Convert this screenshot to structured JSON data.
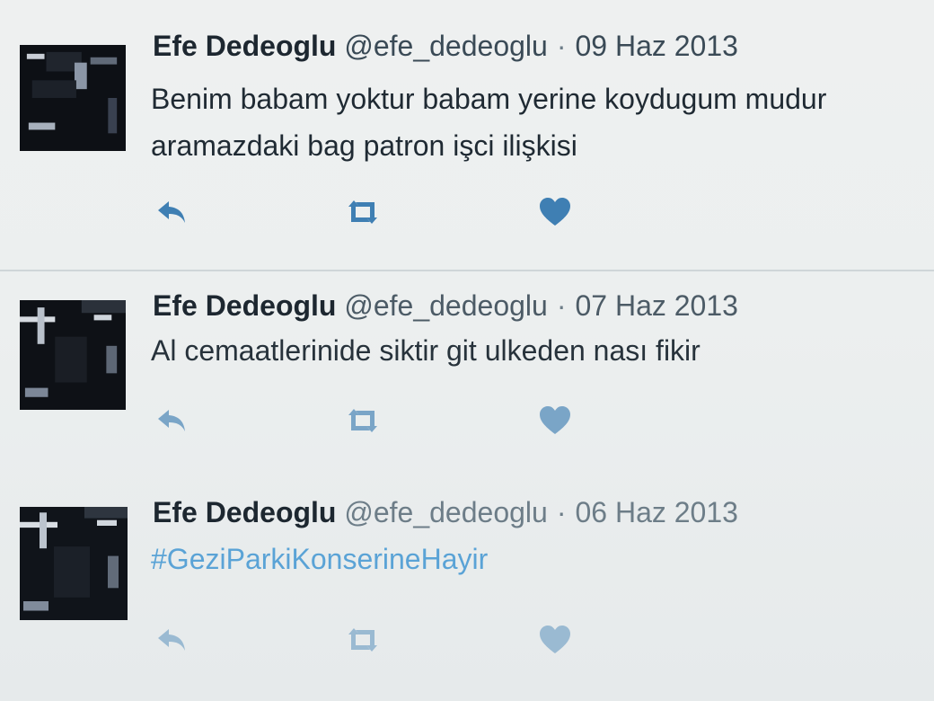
{
  "tweets": [
    {
      "name": "Efe Dedeoglu",
      "handle": "@efe_dedeoglu",
      "separator": "·",
      "date": "09 Haz 2013",
      "text_lines": [
        "Benim babam yoktur babam yerine koydugum mudur",
        "aramazdaki bag patron işci ilişkisi"
      ]
    },
    {
      "name": "Efe Dedeoglu",
      "handle": "@efe_dedeoglu",
      "separator": "·",
      "date": "07 Haz 2013",
      "text_lines": [
        "Al cemaatlerinide siktir git ulkeden nası fikir"
      ]
    },
    {
      "name": "Efe Dedeoglu",
      "handle": "@efe_dedeoglu",
      "separator": "·",
      "date": "06 Haz 2013",
      "text_lines": [
        "#GeziParkiKonserineHayir"
      ]
    }
  ],
  "icons": {
    "reply": "reply-icon",
    "retweet": "retweet-icon",
    "like": "heart-icon"
  },
  "colors": {
    "action_icon": "#3f7fb3",
    "hashtag": "#5aa3d6",
    "background": "#eef0f0"
  }
}
